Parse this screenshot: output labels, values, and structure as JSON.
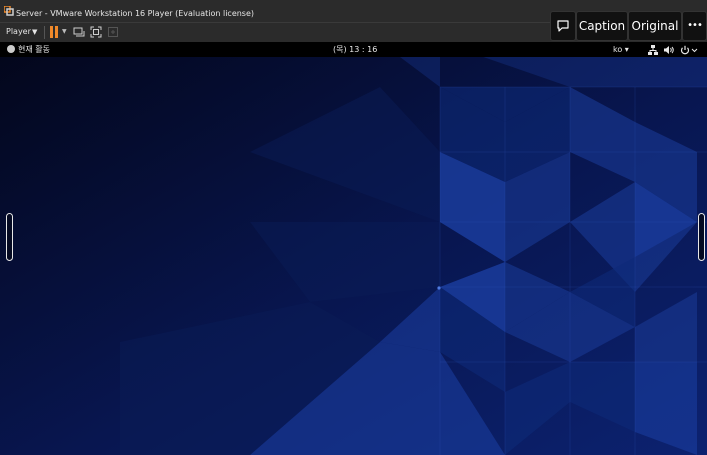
{
  "window": {
    "title": "Server - VMware Workstation 16 Player (Evaluation license)"
  },
  "toolbar": {
    "player_menu_label": "Player",
    "player_menu_caret": "▼",
    "pause_caret": "▼",
    "accent_color": "#f0892a"
  },
  "overlay_buttons": {
    "caption_label": "Caption",
    "original_label": "Original",
    "more_label": "•••"
  },
  "guest": {
    "activities_label": "현재 활동",
    "clock": "(목) 13 : 16",
    "language": "ko",
    "language_caret": "▾",
    "wallpaper_colors": [
      "#050a22",
      "#0c1d55",
      "#17358c"
    ]
  }
}
